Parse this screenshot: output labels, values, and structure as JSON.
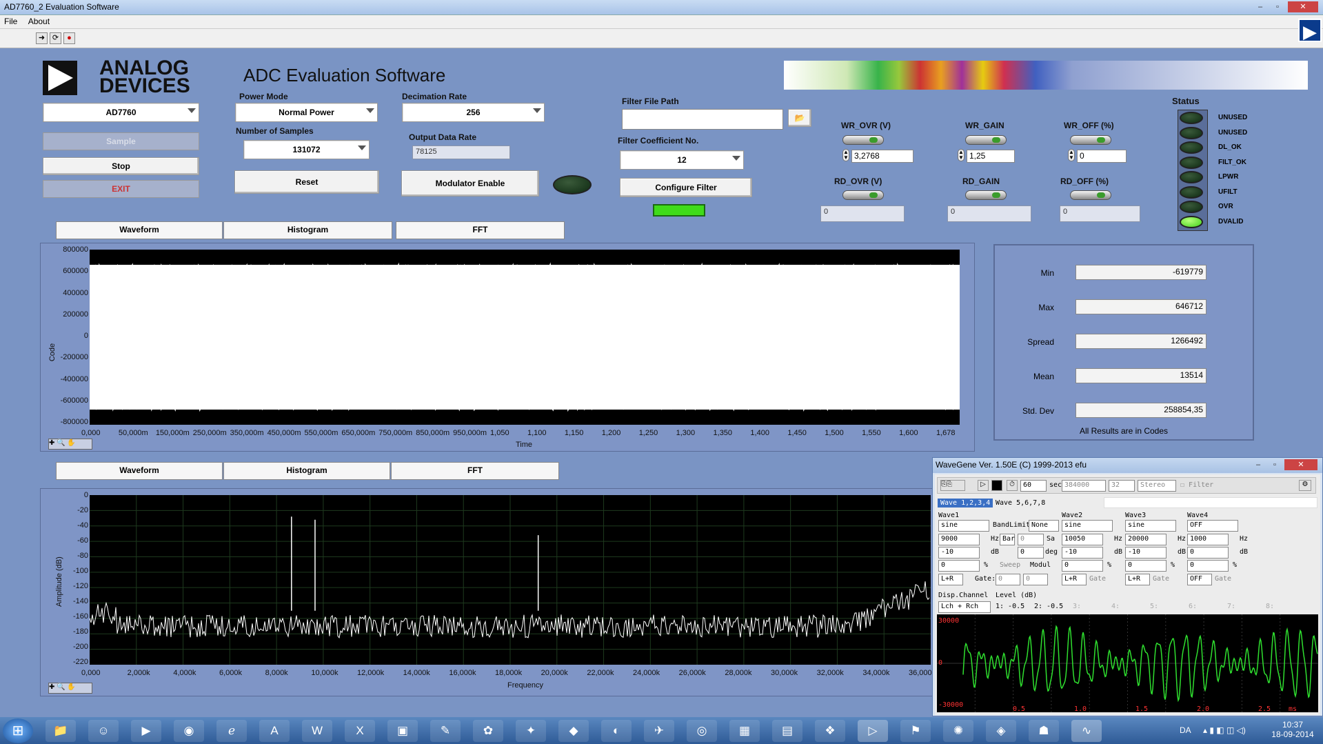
{
  "window": {
    "title": "AD7760_2 Evaluation Software"
  },
  "menu": [
    "File",
    "About"
  ],
  "header": {
    "logo_line1": "ANALOG",
    "logo_line2": "DEVICES",
    "app_title": "ADC Evaluation Software"
  },
  "controls": {
    "device": "AD7760",
    "sample": "Sample",
    "stop": "Stop",
    "exit": "EXIT",
    "power_mode_label": "Power Mode",
    "power_mode": "Normal Power",
    "num_samples_label": "Number of Samples",
    "num_samples": "131072",
    "reset": "Reset",
    "decimation_label": "Decimation Rate",
    "decimation": "256",
    "odr_label": "Output Data Rate",
    "odr": "78125",
    "modulator": "Modulator Enable",
    "filter_path_label": "Filter File Path",
    "filter_path": "",
    "filter_coeff_label": "Filter Coefficient No.",
    "filter_coeff": "12",
    "configure_filter": "Configure Filter"
  },
  "registers": {
    "wr_ovr_label": "WR_OVR (V)",
    "wr_ovr": "3,2768",
    "wr_gain_label": "WR_GAIN",
    "wr_gain": "1,25",
    "wr_off_label": "WR_OFF (%)",
    "wr_off": "0",
    "rd_ovr_label": "RD_OVR (V)",
    "rd_ovr": "0",
    "rd_gain_label": "RD_GAIN",
    "rd_gain": "0",
    "rd_off_label": "RD_OFF (%)",
    "rd_off": "0"
  },
  "status": {
    "title": "Status",
    "items": [
      {
        "label": "UNUSED",
        "on": false
      },
      {
        "label": "UNUSED",
        "on": false
      },
      {
        "label": "DL_OK",
        "on": false
      },
      {
        "label": "FILT_OK",
        "on": false
      },
      {
        "label": "LPWR",
        "on": false
      },
      {
        "label": "UFILT",
        "on": false
      },
      {
        "label": "OVR",
        "on": false
      },
      {
        "label": "DVALID",
        "on": true
      }
    ]
  },
  "tabs_top": [
    "Waveform",
    "Histogram",
    "FFT"
  ],
  "tabs_bottom": [
    "Waveform",
    "Histogram",
    "FFT"
  ],
  "results": {
    "min_label": "Min",
    "min": "-619779",
    "max_label": "Max",
    "max": "646712",
    "spread_label": "Spread",
    "spread": "1266492",
    "mean_label": "Mean",
    "mean": "13514",
    "std_label": "Std. Dev",
    "std": "258854,35",
    "note": "All Results are in Codes"
  },
  "waveform_plot": {
    "ylabel": "Code",
    "xlabel": "Time",
    "yticks": [
      "800000",
      "600000",
      "400000",
      "200000",
      "0",
      "-200000",
      "-400000",
      "-600000",
      "-800000"
    ],
    "xticks": [
      "0,000",
      "50,000m",
      "150,000m",
      "250,000m",
      "350,000m",
      "450,000m",
      "550,000m",
      "650,000m",
      "750,000m",
      "850,000m",
      "950,000m",
      "1,050",
      "1,100",
      "1,150",
      "1,200",
      "1,250",
      "1,300",
      "1,350",
      "1,400",
      "1,450",
      "1,500",
      "1,550",
      "1,600",
      "1,678"
    ]
  },
  "fft_plot": {
    "ylabel": "Amplitude (dB)",
    "xlabel": "Frequency",
    "yticks": [
      "0",
      "-20",
      "-40",
      "-60",
      "-80",
      "-100",
      "-120",
      "-140",
      "-160",
      "-180",
      "-200",
      "-220"
    ],
    "xticks": [
      "0,000",
      "2,000k",
      "4,000k",
      "6,000k",
      "8,000k",
      "10,000k",
      "12,000k",
      "14,000k",
      "16,000k",
      "18,000k",
      "20,000k",
      "22,000k",
      "24,000k",
      "26,000k",
      "28,000k",
      "30,000k",
      "32,000k",
      "34,000k",
      "36,000k"
    ]
  },
  "wavegene": {
    "title": "WaveGene  Ver. 1.50E  (C) 1999-2013 efu",
    "duration": "60",
    "sec": "sec",
    "rate": "384000",
    "bits": "32",
    "mode": "Stereo",
    "filter": "Filter",
    "tab1": "Wave 1,2,3,4",
    "tab2": "Wave 5,6,7,8",
    "wave1": {
      "label": "Wave1",
      "type": "sine",
      "freq": "9000",
      "level": "-10",
      "pct": "0",
      "ch": "L+R"
    },
    "bandlimit_label": "BandLimit:",
    "bandlimit": "None",
    "bar": "Bar",
    "sa": "0",
    "sa_unit": "Sa",
    "deg": "0",
    "deg_unit": "deg",
    "sweep": "Sweep",
    "modul": "Modul",
    "gate_label": "Gate:",
    "gate1": "0",
    "gate2": "0",
    "wave2": {
      "label": "Wave2",
      "type": "sine",
      "freq": "10050",
      "level": "-10",
      "pct": "0",
      "ch": "L+R"
    },
    "wave3": {
      "label": "Wave3",
      "type": "sine",
      "freq": "20000",
      "level": "-10",
      "pct": "0",
      "ch": "L+R"
    },
    "wave4": {
      "label": "Wave4",
      "type": "OFF",
      "freq": "1000",
      "level": "0",
      "pct": "0",
      "ch": "OFF"
    },
    "hz": "Hz",
    "db": "dB",
    "pctu": "%",
    "gate": "Gate",
    "disp_label": "Disp.Channel",
    "disp": "Lch + Rch",
    "level_label": "Level (dB)",
    "level1": "1: -0.5",
    "level2": "2: -0.5",
    "level3": "3:",
    "level4": "4:",
    "level5": "5:",
    "level6": "6:",
    "level7": "7:",
    "level8": "8:",
    "scope_y": [
      "30000",
      "0",
      "-30000"
    ],
    "scope_x": [
      "0.5",
      "1.0",
      "1.5",
      "2.0",
      "2.5"
    ],
    "scope_unit": "ms"
  },
  "taskbar": {
    "lang": "DA",
    "time": "10:37",
    "date": "18-09-2014"
  }
}
